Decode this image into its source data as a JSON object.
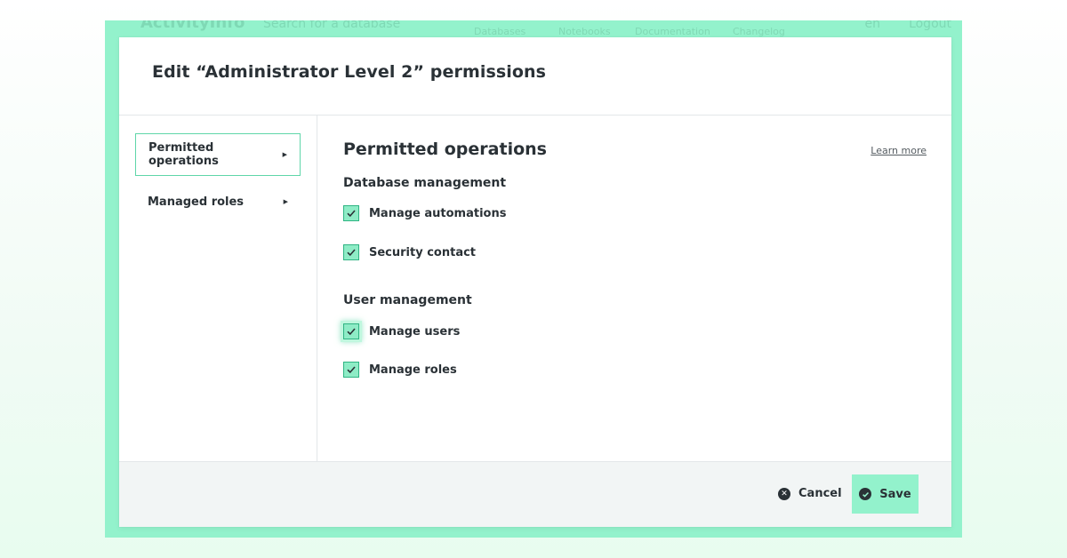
{
  "background_app": {
    "brand": "ActivityInfo",
    "search_placeholder": "Search for a database",
    "language": "en",
    "login": "Logout",
    "subnav": [
      "Databases",
      "Notebooks",
      "Documentation",
      "Changelog"
    ]
  },
  "modal": {
    "title": "Edit “Administrator Level 2” permissions",
    "sidebar": {
      "items": [
        {
          "label": "Permitted operations",
          "active": true
        },
        {
          "label": "Managed roles",
          "active": false
        }
      ]
    },
    "content": {
      "title": "Permitted operations",
      "learn_more": "Learn more",
      "groups": [
        {
          "title": "Database management",
          "items": [
            {
              "label": "Manage automations",
              "checked": true
            },
            {
              "label": "Security contact",
              "checked": true
            }
          ]
        },
        {
          "title": "User management",
          "items": [
            {
              "label": "Manage users",
              "checked": true
            },
            {
              "label": "Manage roles",
              "checked": true
            }
          ]
        }
      ]
    },
    "footer": {
      "cancel_label": "Cancel",
      "save_label": "Save"
    }
  },
  "colors": {
    "accent": "#93f2cc",
    "accent_border": "#2fb483",
    "text": "#2a3136",
    "footer_bg": "#f2f5f5"
  }
}
